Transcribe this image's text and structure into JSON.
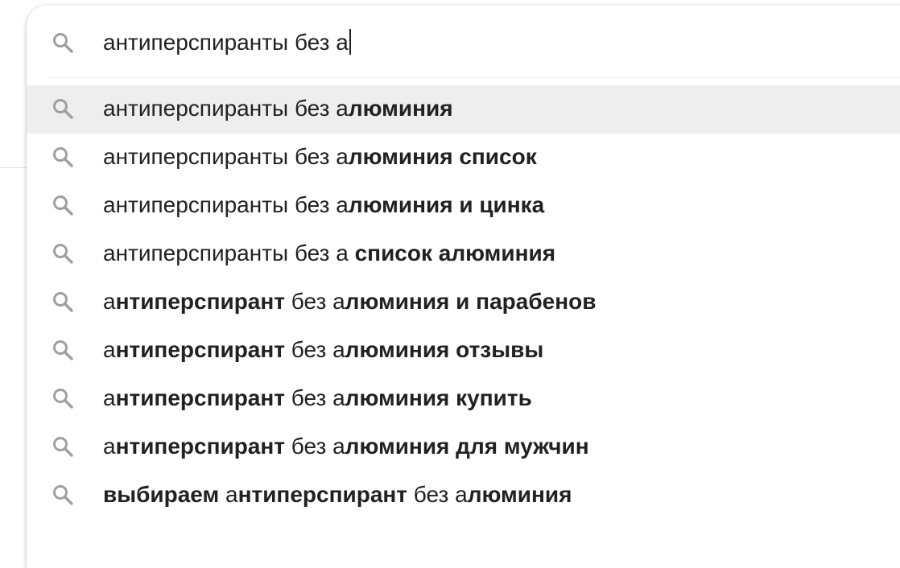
{
  "search": {
    "query": "антиперспиранты без а",
    "icon": "search-icon"
  },
  "suggestions": [
    {
      "segments": [
        {
          "text": "антиперспиранты без а",
          "bold": false
        },
        {
          "text": "люминия",
          "bold": true
        }
      ],
      "active": true
    },
    {
      "segments": [
        {
          "text": "антиперспиранты без а",
          "bold": false
        },
        {
          "text": "люминия список",
          "bold": true
        }
      ],
      "active": false
    },
    {
      "segments": [
        {
          "text": "антиперспиранты без а",
          "bold": false
        },
        {
          "text": "люминия и цинка",
          "bold": true
        }
      ],
      "active": false
    },
    {
      "segments": [
        {
          "text": "антиперспиранты без а ",
          "bold": false
        },
        {
          "text": "список алюминия",
          "bold": true
        }
      ],
      "active": false
    },
    {
      "segments": [
        {
          "text": "а",
          "bold": false
        },
        {
          "text": "нтиперспирант",
          "bold": true
        },
        {
          "text": " без а",
          "bold": false
        },
        {
          "text": "люминия и парабенов",
          "bold": true
        }
      ],
      "active": false
    },
    {
      "segments": [
        {
          "text": "а",
          "bold": false
        },
        {
          "text": "нтиперспирант",
          "bold": true
        },
        {
          "text": " без а",
          "bold": false
        },
        {
          "text": "люминия отзывы",
          "bold": true
        }
      ],
      "active": false
    },
    {
      "segments": [
        {
          "text": "а",
          "bold": false
        },
        {
          "text": "нтиперспирант",
          "bold": true
        },
        {
          "text": " без а",
          "bold": false
        },
        {
          "text": "люминия купить",
          "bold": true
        }
      ],
      "active": false
    },
    {
      "segments": [
        {
          "text": "а",
          "bold": false
        },
        {
          "text": "нтиперспирант",
          "bold": true
        },
        {
          "text": " без а",
          "bold": false
        },
        {
          "text": "люминия для мужчин",
          "bold": true
        }
      ],
      "active": false
    },
    {
      "segments": [
        {
          "text": "выбираем",
          "bold": true
        },
        {
          "text": " а",
          "bold": false
        },
        {
          "text": "нтиперспирант",
          "bold": true
        },
        {
          "text": " без а",
          "bold": false
        },
        {
          "text": "люминия",
          "bold": true
        }
      ],
      "active": false
    }
  ],
  "colors": {
    "text": "#202124",
    "icon": "#9aa0a6",
    "highlight": "#eeeeee"
  }
}
